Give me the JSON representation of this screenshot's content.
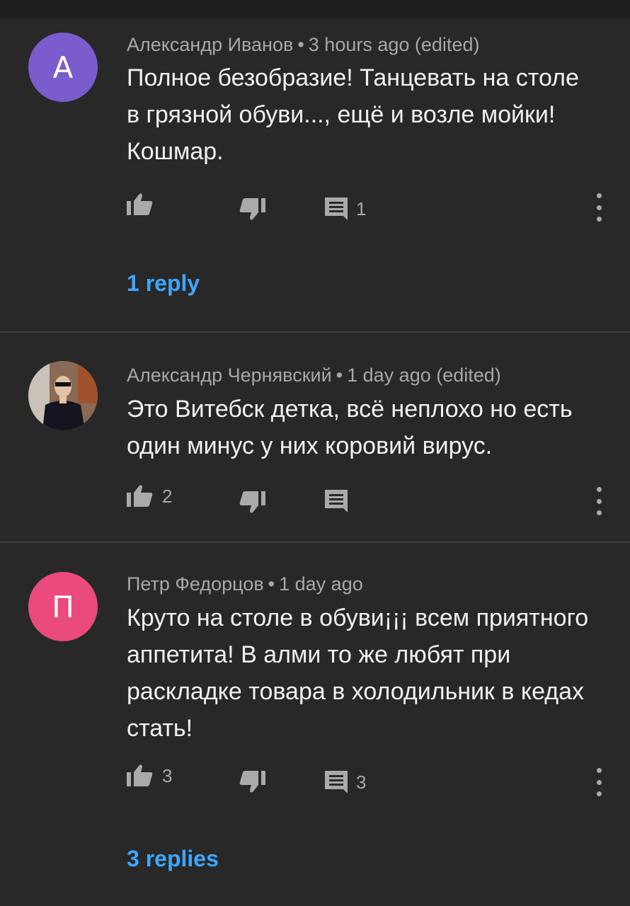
{
  "comments": [
    {
      "author": "Александр Иванов",
      "time": "3 hours ago",
      "edited": "(edited)",
      "avatar_letter": "А",
      "avatar_color": "#7b5ccc",
      "lines": [
        "Полное безобразие! Танцевать  на столе",
        "в грязной обуви..., ещё и возле мойки!",
        "Кошмар."
      ],
      "likes": "",
      "replies_count": "1",
      "replies_link": "1 reply"
    },
    {
      "author": "Александр Чернявский",
      "time": "1 day ago",
      "edited": "(edited)",
      "avatar_letter": "",
      "avatar_color": "#5a4a3e",
      "lines": [
        "Это Витебск детка, всё неплохо но есть",
        "один минус у них коровий вирус."
      ],
      "likes": "2",
      "replies_count": "",
      "replies_link": ""
    },
    {
      "author": "Петр Федорцов",
      "time": "1 day ago",
      "edited": "",
      "avatar_letter": "П",
      "avatar_color": "#ea4b7c",
      "lines": [
        "Круто на столе в обуви¡¡¡ всем приятного",
        "аппетита! В алми то же любят при",
        "раскладке товара в холодильник в кедах",
        "стать!"
      ],
      "likes": "3",
      "replies_count": "3",
      "replies_link": "3 replies"
    }
  ],
  "separator": "•",
  "icons": {
    "like": "thumbs-up-icon",
    "dislike": "thumbs-down-icon",
    "reply": "comment-icon",
    "more": "more-vert-icon"
  },
  "colors": {
    "background": "#282828",
    "link": "#3ea6ff",
    "meta": "#a8a8a8"
  }
}
